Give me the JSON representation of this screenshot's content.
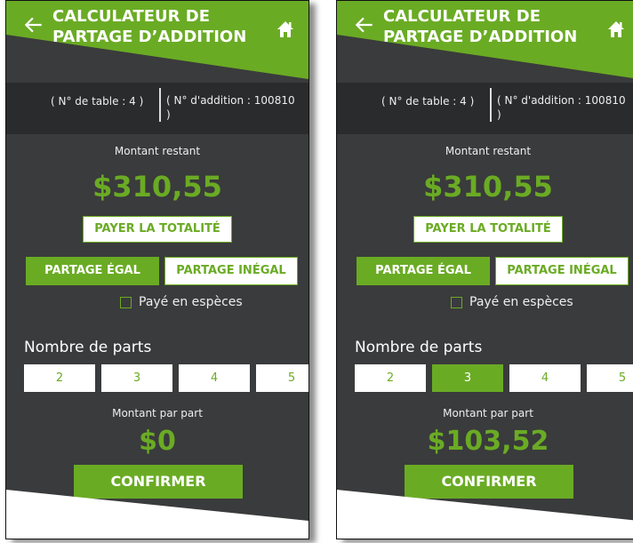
{
  "screens": [
    {
      "title_line1": "CALCULATEUR DE",
      "title_line2": "PARTAGE D’ADDITION",
      "table_info": "( N° de table : 4 )",
      "bill_info": "( N° d'addition : 100810 )",
      "remaining_label": "Montant restant",
      "remaining_amount": "$310,55",
      "pay_all_label": "PAYER LA TOTALITÉ",
      "equal_split_label": "PARTAGE ÉGAL",
      "unequal_split_label": "PARTAGE INÉGAL",
      "cash_label": "Payé en espèces",
      "parts_heading": "Nombre de parts",
      "parts": [
        "2",
        "3",
        "4",
        "5"
      ],
      "selected_part": null,
      "per_part_label": "Montant par part",
      "per_part_amount": "$0",
      "confirm_label": "CONFIRMER"
    },
    {
      "title_line1": "CALCULATEUR DE",
      "title_line2": "PARTAGE D’ADDITION",
      "table_info": "( N° de table : 4 )",
      "bill_info": "( N° d'addition : 100810 )",
      "remaining_label": "Montant restant",
      "remaining_amount": "$310,55",
      "pay_all_label": "PAYER LA TOTALITÉ",
      "equal_split_label": "PARTAGE ÉGAL",
      "unequal_split_label": "PARTAGE INÉGAL",
      "cash_label": "Payé en espèces",
      "parts_heading": "Nombre de parts",
      "parts": [
        "2",
        "3",
        "4",
        "5"
      ],
      "selected_part": "3",
      "per_part_label": "Montant par part",
      "per_part_amount": "$103,52",
      "confirm_label": "CONFIRMER"
    }
  ],
  "colors": {
    "accent": "#6aab24",
    "background": "#3a3b3c",
    "info_strip": "#2a2b2c"
  },
  "icons": {
    "back": "back-arrow-icon",
    "home": "home-icon"
  }
}
